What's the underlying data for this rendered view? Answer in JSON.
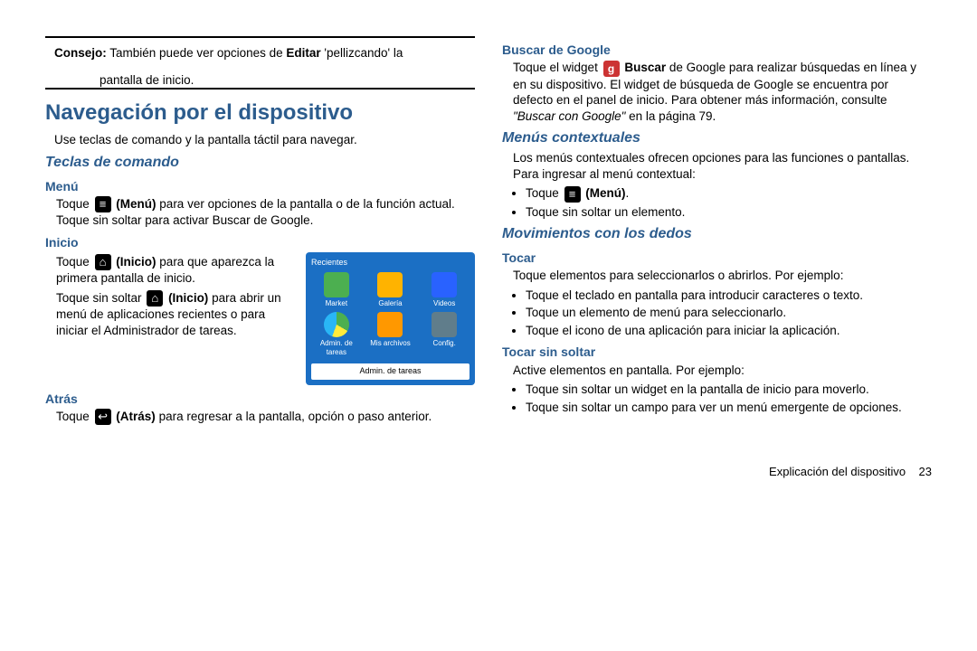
{
  "tip": {
    "label": "Consejo:",
    "text1": " También puede ver opciones de ",
    "bold1": "Editar",
    "text2": " 'pellizcando' la",
    "line2": "pantalla de inicio."
  },
  "nav": {
    "title": "Navegación por el dispositivo",
    "intro": "Use teclas de comando y la pantalla táctil para navegar."
  },
  "teclas": {
    "title": "Teclas de comando",
    "menu": {
      "title": "Menú",
      "p1a": "Toque ",
      "p1b": " (Menú)",
      "p1c": " para ver opciones de la pantalla o de la función actual. Toque sin soltar para activar Buscar de Google."
    },
    "inicio": {
      "title": "Inicio",
      "p1a": "Toque ",
      "p1b": " (Inicio)",
      "p1c": " para que aparezca la primera pantalla de inicio.",
      "p2a": "Toque sin soltar ",
      "p2b": " (Inicio)",
      "p2c": " para abrir un menú de aplicaciones recientes o para iniciar el Administrador de tareas."
    },
    "atras": {
      "title": "Atrás",
      "p1a": "Toque ",
      "p1b": " (Atrás)",
      "p1c": " para regresar a la pantalla, opción o paso anterior."
    }
  },
  "widget": {
    "title": "Recientes",
    "apps": [
      "Market",
      "Galería",
      "Videos",
      "Admin. de tareas",
      "Mis archivos",
      "Config."
    ],
    "button": "Admin. de tareas"
  },
  "google": {
    "title": "Buscar de Google",
    "p1a": "Toque el widget ",
    "p1b": " Buscar",
    "p1c": " de Google para realizar búsquedas en línea y en su dispositivo. El widget de búsqueda de Google se encuentra por defecto en el panel de inicio. Para obtener más información, consulte ",
    "ref": "\"Buscar con Google\"",
    "p1d": " en la página 79."
  },
  "context": {
    "title": "Menús contextuales",
    "intro": "Los menús contextuales ofrecen opciones para las funciones o pantallas. Para ingresar al menú contextual:",
    "b1a": "Toque ",
    "b1b": " (Menú)",
    "b1c": ".",
    "b2": "Toque sin soltar un elemento."
  },
  "mov": {
    "title": "Movimientos con los dedos",
    "tocar": {
      "title": "Tocar",
      "intro": "Toque elementos para seleccionarlos o abrirlos. Por ejemplo:",
      "b1": "Toque el teclado en pantalla para introducir caracteres o texto.",
      "b2": "Toque un elemento de menú para seleccionarlo.",
      "b3": "Toque el icono de una aplicación para iniciar la aplicación."
    },
    "hold": {
      "title": "Tocar sin soltar",
      "intro": "Active elementos en pantalla. Por ejemplo:",
      "b1": "Toque sin soltar un widget en la pantalla de inicio para moverlo.",
      "b2": "Toque sin soltar un campo para ver un menú emergente de opciones."
    }
  },
  "footer": {
    "text": "Explicación del dispositivo",
    "page": "23"
  }
}
